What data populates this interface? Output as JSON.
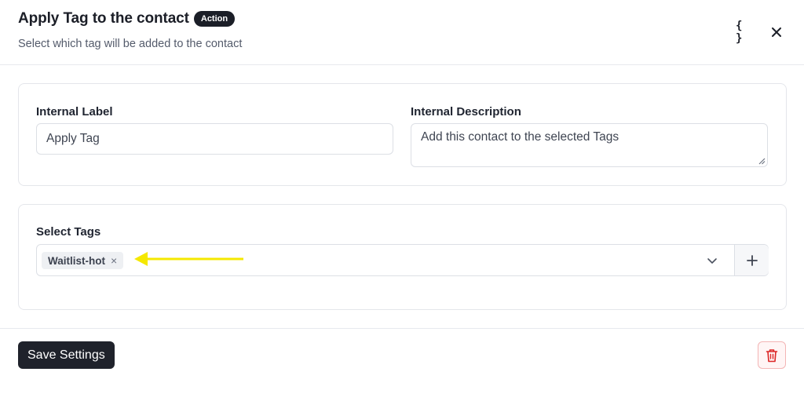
{
  "header": {
    "title": "Apply Tag to the contact",
    "badge": "Action",
    "subtitle": "Select which tag will be added to the contact",
    "code_button_label": "{ }",
    "code_icon": "curly-braces-icon",
    "close_icon": "close-icon"
  },
  "settings_card": {
    "internal_label": {
      "label": "Internal Label",
      "value": "Apply Tag"
    },
    "internal_description": {
      "label": "Internal Description",
      "value": "Add this contact to the selected Tags"
    }
  },
  "tags_card": {
    "label": "Select Tags",
    "selected_tags": [
      "Waitlist-hot"
    ],
    "remove_icon": "×",
    "dropdown_icon": "chevron-down-icon",
    "add_button_label": "+",
    "annotation_arrow_color": "#f5e800"
  },
  "footer": {
    "save_label": "Save Settings",
    "delete_icon": "trash-icon",
    "delete_color": "#dc2626"
  }
}
